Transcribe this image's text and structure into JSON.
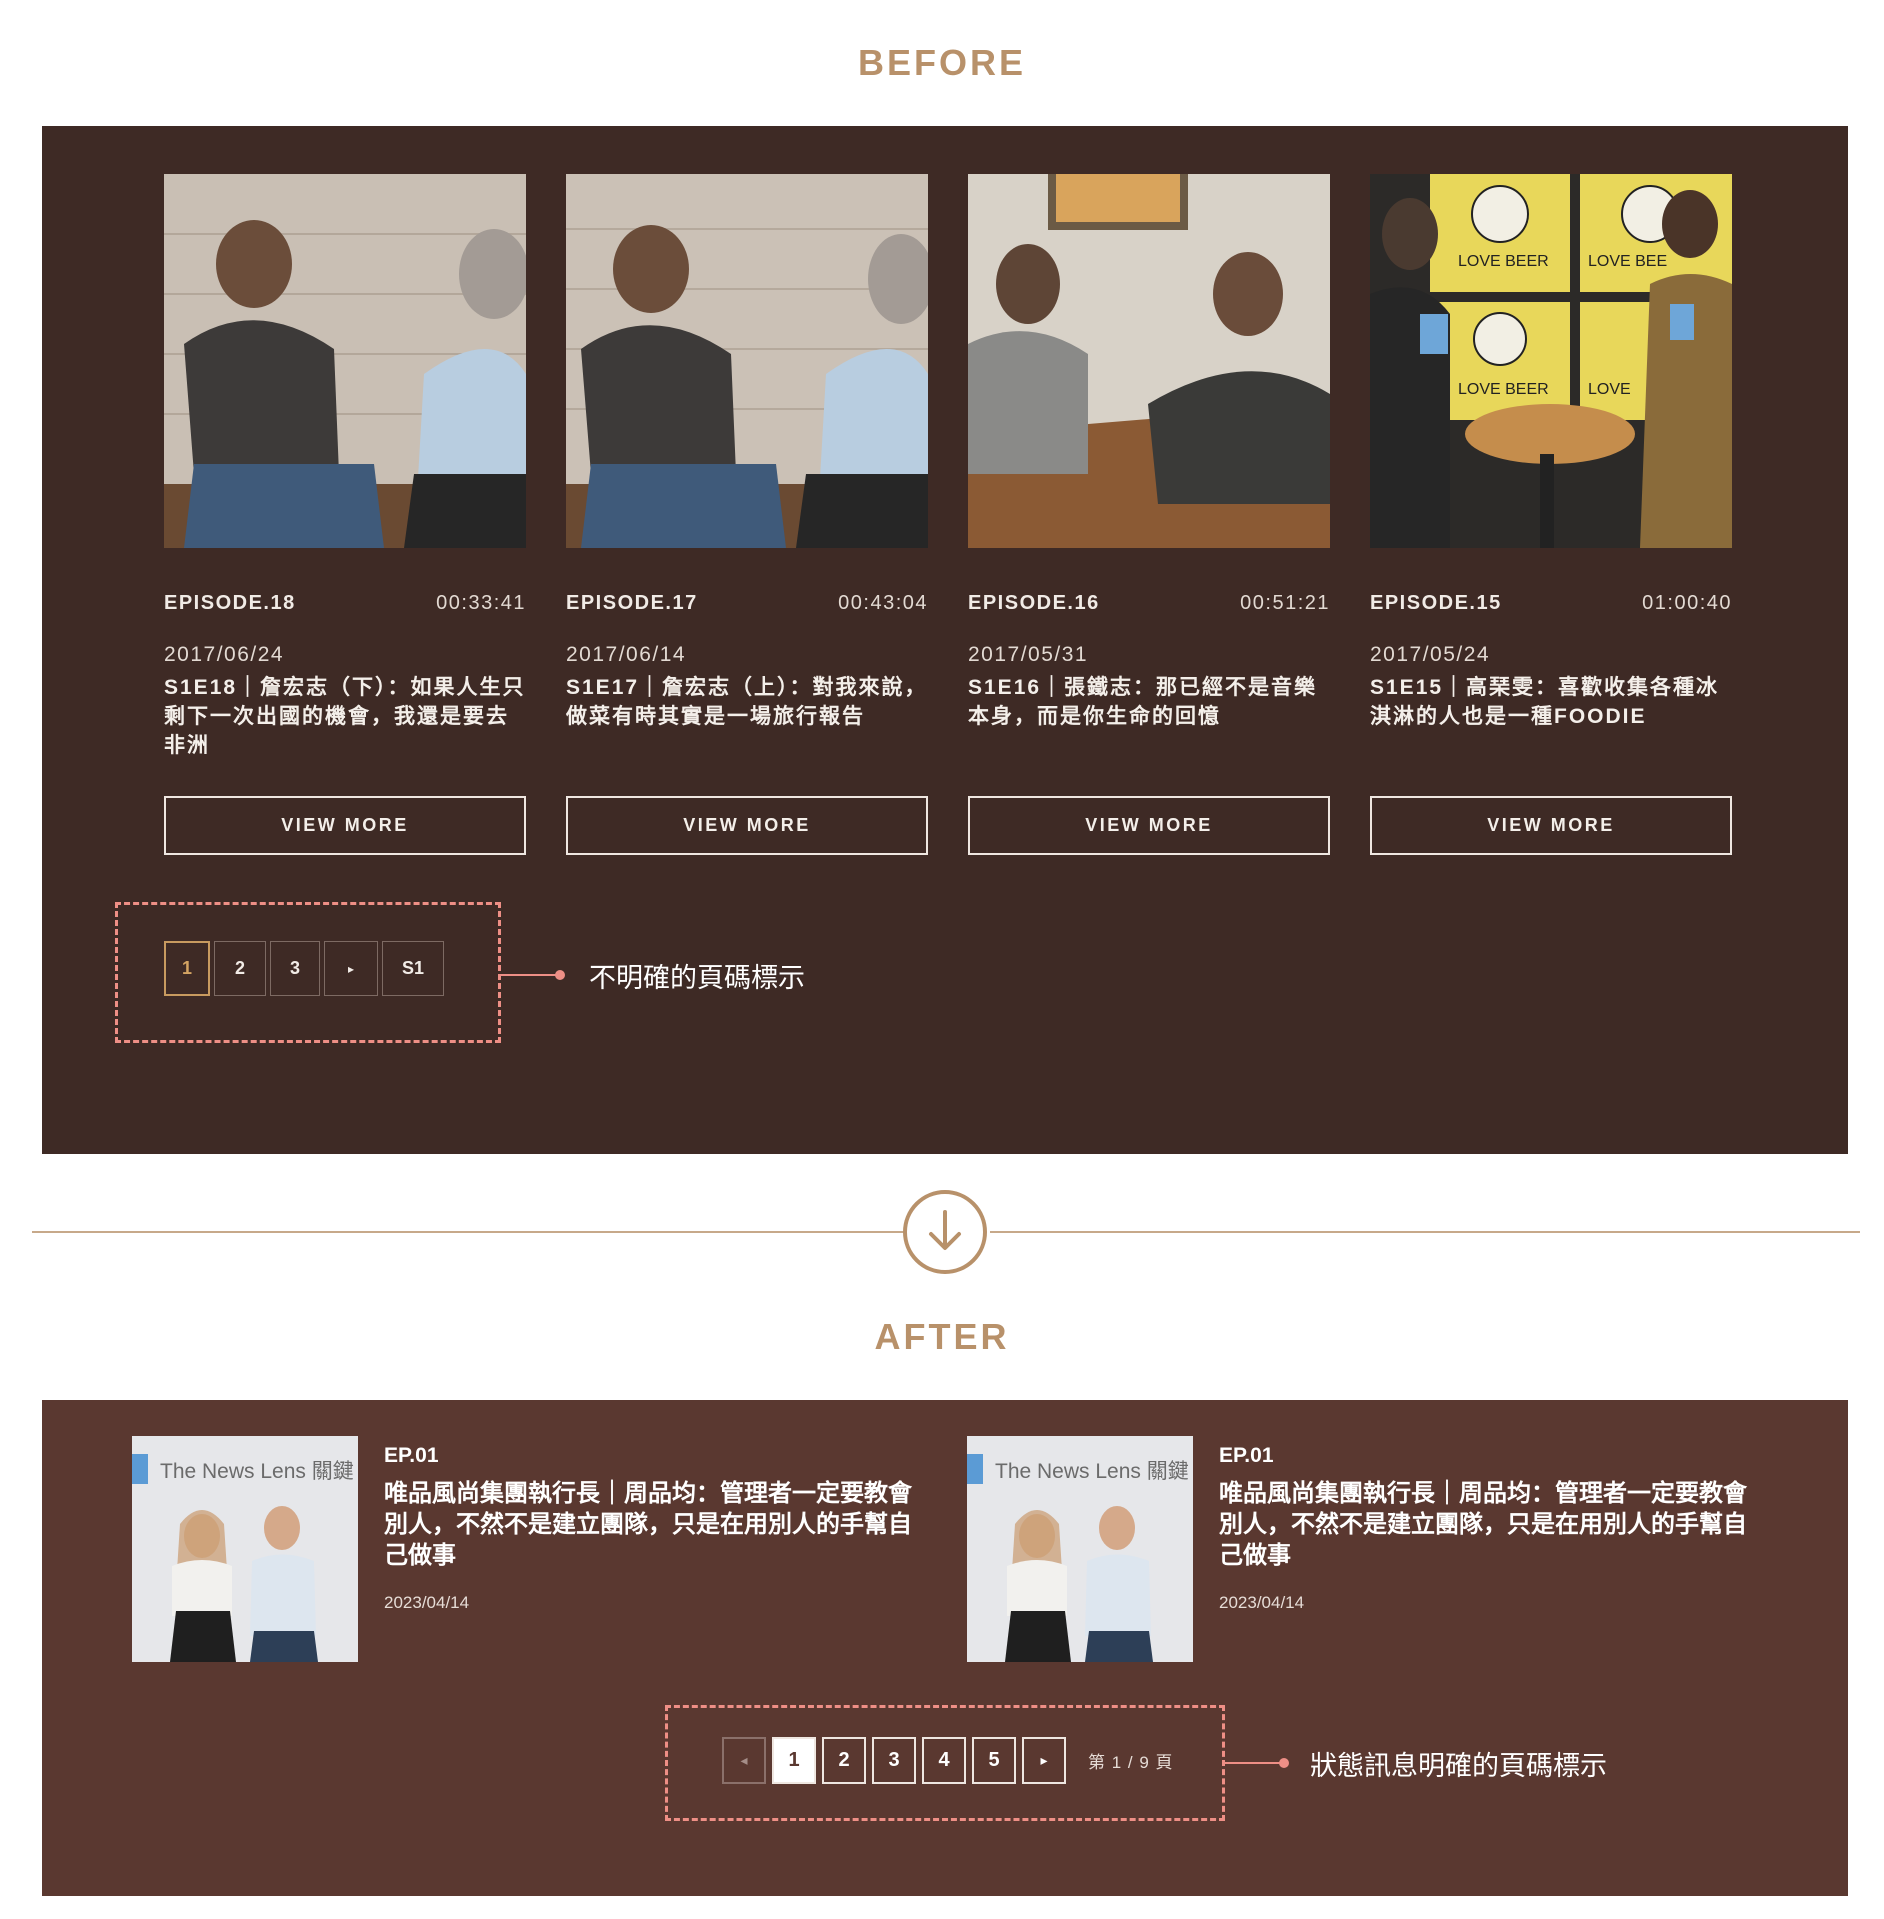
{
  "before": {
    "title": "BEFORE",
    "episodes": [
      {
        "num": "EPISODE.18",
        "time": "00:33:41",
        "date": "2017/06/24",
        "title": "S1E18｜詹宏志（下）：如果人生只剩下一次出國的機會，我還是要去非洲",
        "button": "VIEW MORE"
      },
      {
        "num": "EPISODE.17",
        "time": "00:43:04",
        "date": "2017/06/14",
        "title": "S1E17｜詹宏志（上）：對我來說，做菜有時其實是一場旅行報告",
        "button": "VIEW MORE"
      },
      {
        "num": "EPISODE.16",
        "time": "00:51:21",
        "date": "2017/05/31",
        "title": "S1E16｜張鐵志：那已經不是音樂本身，而是你生命的回憶",
        "button": "VIEW MORE"
      },
      {
        "num": "EPISODE.15",
        "time": "01:00:40",
        "date": "2017/05/24",
        "title": "S1E15｜高琹雯：喜歡收集各種冰淇淋的人也是一種FOODIE",
        "button": "VIEW MORE"
      }
    ],
    "pager": [
      "1",
      "2",
      "3",
      "▸",
      "S1"
    ],
    "callout": "不明確的頁碼標示",
    "thumb_texts": [
      "LOVE BEER",
      "LOVE BEE",
      "LOVE BEER",
      "LOVE"
    ]
  },
  "after": {
    "title": "AFTER",
    "cards": [
      {
        "ep": "EP.01",
        "title": "唯品風尚集團執行長｜周品均：管理者一定要教會別人，不然不是建立團隊，只是在用別人的手幫自己做事",
        "date": "2023/04/14",
        "brand": "The News Lens 關鍵"
      },
      {
        "ep": "EP.01",
        "title": "唯品風尚集團執行長｜周品均：管理者一定要教會別人，不然不是建立團隊，只是在用別人的手幫自己做事",
        "date": "2023/04/14",
        "brand": "The News Lens 關鍵"
      }
    ],
    "pager": {
      "prev": "◂",
      "pages": [
        "1",
        "2",
        "3",
        "4",
        "5"
      ],
      "next": "▸",
      "status": "第 1 / 9 頁"
    },
    "callout": "狀態訊息明確的頁碼標示"
  },
  "colors": {
    "accent": "#b8916a",
    "before_bg": "#3e2a25",
    "after_bg": "#5a3830",
    "callout": "#ee8f86"
  },
  "icons": {
    "divider": "arrow-down-circle-icon"
  }
}
